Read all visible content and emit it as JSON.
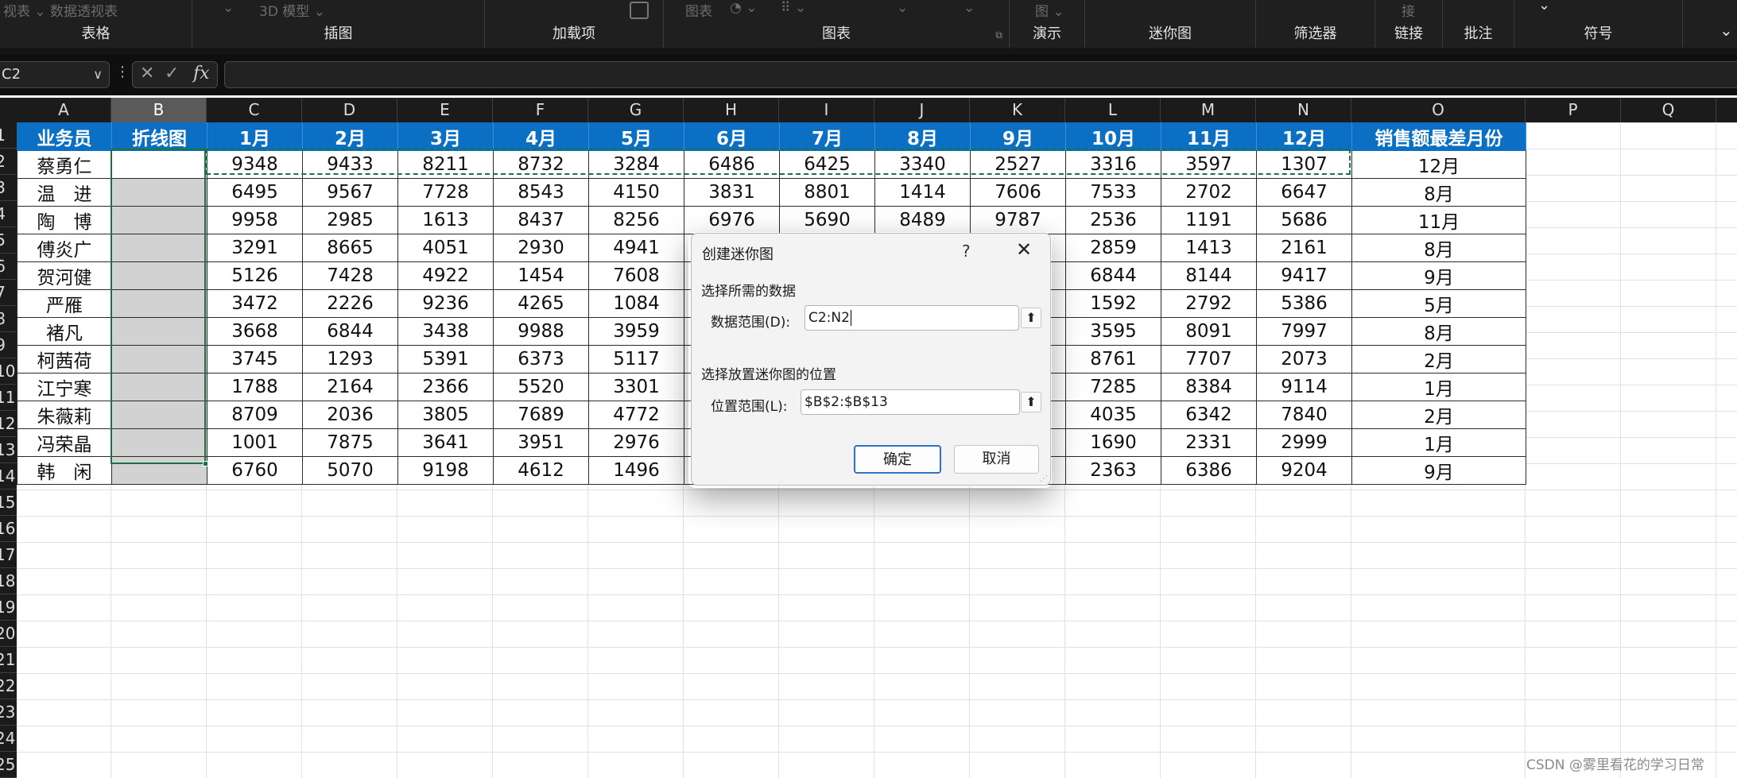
{
  "ribbon": {
    "faint_items": [
      "视表 ⌄  数据透视表",
      "⌄",
      "3D 模型  ⌄",
      "图表",
      "◔ ⌄",
      "⠿ ⌄",
      "⌄",
      "⌄",
      "图 ⌄",
      "接"
    ],
    "groups": [
      {
        "id": "table",
        "label": "表格"
      },
      {
        "id": "illustrations",
        "label": "插图"
      },
      {
        "id": "addins",
        "label": "加载项"
      },
      {
        "id": "charts",
        "label": "图表"
      },
      {
        "id": "tours",
        "label": "演示"
      },
      {
        "id": "sparklines",
        "label": "迷你图"
      },
      {
        "id": "filters",
        "label": "筛选器"
      },
      {
        "id": "links",
        "label": "链接"
      },
      {
        "id": "comments",
        "label": "批注"
      },
      {
        "id": "symbols",
        "label": "符号"
      }
    ]
  },
  "formula_bar": {
    "name_box": "C2",
    "formula": ""
  },
  "grid": {
    "columns": [
      "A",
      "B",
      "C",
      "D",
      "E",
      "F",
      "G",
      "H",
      "I",
      "J",
      "K",
      "L",
      "M",
      "N",
      "O",
      "P",
      "Q"
    ],
    "selected_column": "B",
    "rows": [
      "1",
      "2",
      "3",
      "4",
      "5",
      "6",
      "7",
      "8",
      "9",
      "10",
      "11",
      "12",
      "13",
      "14",
      "15",
      "16",
      "17",
      "18",
      "19",
      "20",
      "21",
      "22",
      "23",
      "24",
      "25"
    ],
    "header": [
      "业务员",
      "折线图",
      "1月",
      "2月",
      "3月",
      "4月",
      "5月",
      "6月",
      "7月",
      "8月",
      "9月",
      "10月",
      "11月",
      "12月",
      "销售额最差月份"
    ],
    "data": [
      [
        "蔡勇仁",
        "",
        "9348",
        "9433",
        "8211",
        "8732",
        "3284",
        "6486",
        "6425",
        "3340",
        "2527",
        "3316",
        "3597",
        "1307",
        "12月"
      ],
      [
        "温　进",
        "",
        "6495",
        "9567",
        "7728",
        "8543",
        "4150",
        "3831",
        "8801",
        "1414",
        "7606",
        "7533",
        "2702",
        "6647",
        "8月"
      ],
      [
        "陶　博",
        "",
        "9958",
        "2985",
        "1613",
        "8437",
        "8256",
        "6976",
        "5690",
        "8489",
        "9787",
        "2536",
        "1191",
        "5686",
        "11月"
      ],
      [
        "傅炎广",
        "",
        "3291",
        "8665",
        "4051",
        "2930",
        "4941",
        "",
        "",
        "",
        "",
        "2859",
        "1413",
        "2161",
        "8月"
      ],
      [
        "贺河健",
        "",
        "5126",
        "7428",
        "4922",
        "1454",
        "7608",
        "",
        "",
        "",
        "",
        "6844",
        "8144",
        "9417",
        "9月"
      ],
      [
        "严雁",
        "",
        "3472",
        "2226",
        "9236",
        "4265",
        "1084",
        "",
        "",
        "",
        "",
        "1592",
        "2792",
        "5386",
        "5月"
      ],
      [
        "褚凡",
        "",
        "3668",
        "6844",
        "3438",
        "9988",
        "3959",
        "",
        "",
        "",
        "",
        "3595",
        "8091",
        "7997",
        "8月"
      ],
      [
        "柯茜荷",
        "",
        "3745",
        "1293",
        "5391",
        "6373",
        "5117",
        "",
        "",
        "",
        "",
        "8761",
        "7707",
        "2073",
        "2月"
      ],
      [
        "江宁寒",
        "",
        "1788",
        "2164",
        "2366",
        "5520",
        "3301",
        "",
        "",
        "",
        "",
        "7285",
        "8384",
        "9114",
        "1月"
      ],
      [
        "朱薇莉",
        "",
        "8709",
        "2036",
        "3805",
        "7689",
        "4772",
        "",
        "",
        "",
        "",
        "4035",
        "6342",
        "7840",
        "2月"
      ],
      [
        "冯荣晶",
        "",
        "1001",
        "7875",
        "3641",
        "3951",
        "2976",
        "",
        "",
        "",
        "",
        "1690",
        "2331",
        "2999",
        "1月"
      ],
      [
        "韩　闲",
        "",
        "6760",
        "5070",
        "9198",
        "4612",
        "1496",
        "",
        "",
        "",
        "",
        "2363",
        "6386",
        "9204",
        "9月"
      ]
    ]
  },
  "dialog": {
    "title": "创建迷你图",
    "help": "?",
    "close": "✕",
    "section1": "选择所需的数据",
    "data_range_label": "数据范围(D):",
    "data_range_value": "C2:N2",
    "section2": "选择放置迷你图的位置",
    "location_label": "位置范围(L):",
    "location_value": "$B$2:$B$13",
    "ok": "确定",
    "cancel": "取消"
  },
  "watermark": "CSDN @雾里看花的学习日常",
  "colors": {
    "header_blue": "#0b70c4",
    "selection_green": "#1e7145",
    "ribbon_bg": "#1f1f1f"
  }
}
